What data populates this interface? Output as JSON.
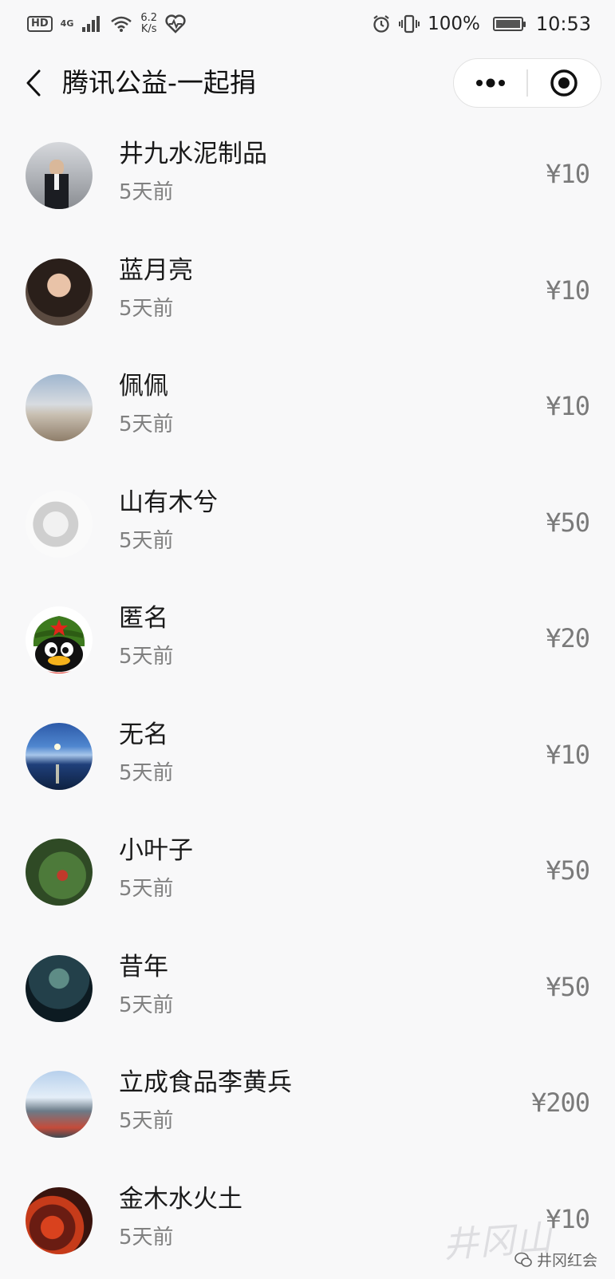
{
  "status_bar": {
    "hd": "HD",
    "network": "4G",
    "speed_value": "6.2",
    "speed_unit": "K/s",
    "battery_pct": "100%",
    "time": "10:53"
  },
  "nav": {
    "title": "腾讯公益-一起捐"
  },
  "donors": [
    {
      "name": "井九水泥制品",
      "time": "5天前",
      "amount": "¥10"
    },
    {
      "name": "蓝月亮",
      "time": "5天前",
      "amount": "¥10"
    },
    {
      "name": "佩佩",
      "time": "5天前",
      "amount": "¥10"
    },
    {
      "name": "山有木兮",
      "time": "5天前",
      "amount": "¥50"
    },
    {
      "name": "匿名",
      "time": "5天前",
      "amount": "¥20"
    },
    {
      "name": "无名",
      "time": "5天前",
      "amount": "¥10"
    },
    {
      "name": "小叶子",
      "time": "5天前",
      "amount": "¥50"
    },
    {
      "name": "昔年",
      "time": "5天前",
      "amount": "¥50"
    },
    {
      "name": "立成食品李黄兵",
      "time": "5天前",
      "amount": "¥200"
    },
    {
      "name": "金木水火土",
      "time": "5天前",
      "amount": "¥10"
    }
  ],
  "watermark": {
    "text": "井冈山",
    "caption": "井冈红会"
  }
}
